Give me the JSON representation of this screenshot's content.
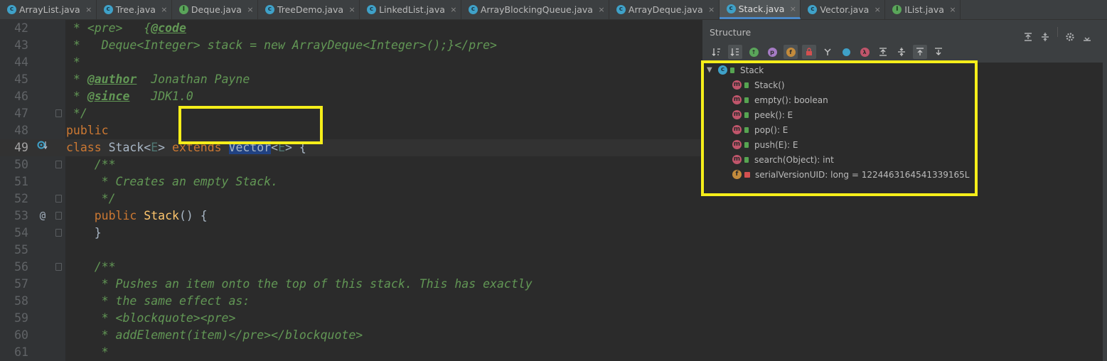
{
  "tabs": [
    {
      "name": "ArrayList.java",
      "icon": "class-icon",
      "active": false
    },
    {
      "name": "Tree.java",
      "icon": "class-icon",
      "active": false
    },
    {
      "name": "Deque.java",
      "icon": "interface-icon",
      "active": false
    },
    {
      "name": "TreeDemo.java",
      "icon": "class-icon",
      "active": false
    },
    {
      "name": "LinkedList.java",
      "icon": "class-icon",
      "active": false
    },
    {
      "name": "ArrayBlockingQueue.java",
      "icon": "class-icon",
      "active": false
    },
    {
      "name": "ArrayDeque.java",
      "icon": "class-icon",
      "active": false
    },
    {
      "name": "Stack.java",
      "icon": "class-icon",
      "active": true
    },
    {
      "name": "Vector.java",
      "icon": "class-icon",
      "active": false
    },
    {
      "name": "IList.java",
      "icon": "interface-icon",
      "active": false
    }
  ],
  "tab_close_glyph": "×",
  "editor": {
    "lines": [
      "42",
      "43",
      "44",
      "45",
      "46",
      "47",
      "48",
      "49",
      "50",
      "51",
      "52",
      "53",
      "54",
      "55",
      "56",
      "57",
      "58",
      "59",
      "60",
      "61"
    ],
    "current_line": "49",
    "code": {
      "l42_star": " * ",
      "l42_pre": "<pre>",
      "l42_gap": "   {",
      "l42_code": "@code",
      "l43": " *   Deque<Integer> stack = new ArrayDeque<Integer>();}</pre>",
      "l44": " *",
      "l45_star": " * ",
      "l45_tag": "@author",
      "l45_val": "  Jonathan Payne",
      "l46_star": " * ",
      "l46_tag": "@since",
      "l46_val": "   JDK1.0",
      "l47": " */",
      "l48": "public",
      "l49_class": "class",
      "l49_name": " Stack<",
      "l49_e1": "E",
      "l49_close1": "> ",
      "l49_extends": "extends",
      "l49_sp": " ",
      "l49_vector": "Vector",
      "l49_lt": "<",
      "l49_e2": "E",
      "l49_tail": "> {",
      "l50": "    /**",
      "l51": "     * Creates an empty Stack.",
      "l52": "     */",
      "l53_public": "    public ",
      "l53_stack": "Stack",
      "l53_rest": "() {",
      "l54": "    }",
      "l55": "",
      "l56": "    /**",
      "l57": "     * Pushes an item onto the top of this stack. This has exactly",
      "l58": "     * the same effect as:",
      "l59": "     * <blockquote><pre>",
      "l60": "     * addElement(item)</pre></blockquote>",
      "l61": "     *"
    }
  },
  "structure": {
    "title": "Structure",
    "root": {
      "name": "Stack",
      "icon": "class-icon"
    },
    "members": [
      {
        "name": "Stack()",
        "kind": "method"
      },
      {
        "name": "empty(): boolean",
        "kind": "method"
      },
      {
        "name": "peek(): E",
        "kind": "method"
      },
      {
        "name": "pop(): E",
        "kind": "method"
      },
      {
        "name": "push(E): E",
        "kind": "method"
      },
      {
        "name": "search(Object): int",
        "kind": "method"
      },
      {
        "name": "serialVersionUID: long = 1224463164541339165L",
        "kind": "field"
      }
    ]
  },
  "colors": {
    "highlight": "#f5ee1a",
    "keyword": "#cc7832",
    "comment": "#629755",
    "method": "#ffc66d"
  }
}
